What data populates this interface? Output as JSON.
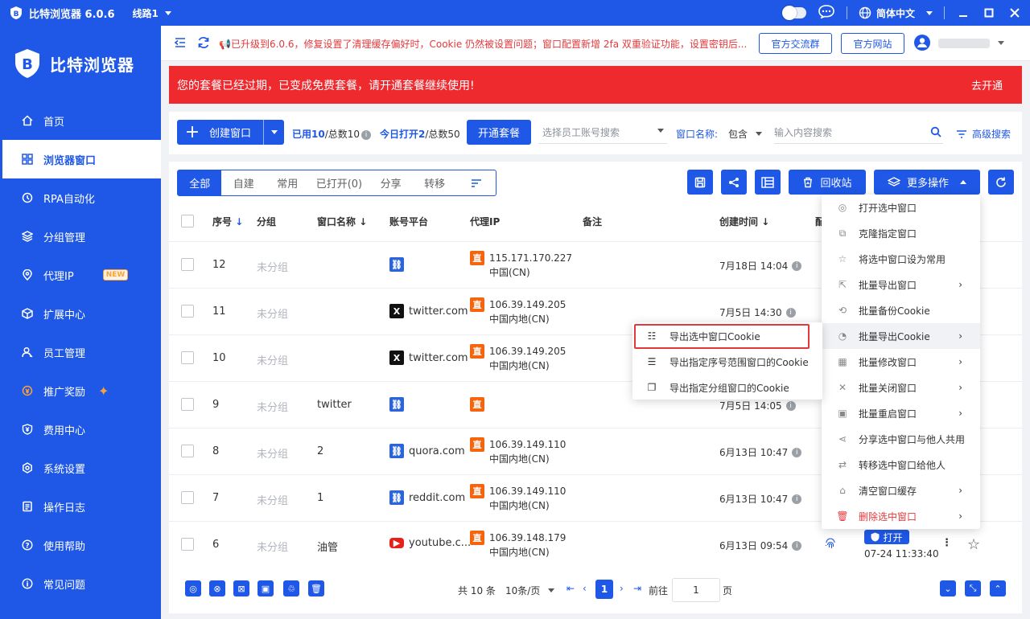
{
  "app": {
    "title": "比特浏览器 6.0.6",
    "route": "线路1",
    "language": "简体中文"
  },
  "sidebar": {
    "brand": "比特浏览器",
    "items": [
      {
        "label": "首页",
        "icon": "home-icon"
      },
      {
        "label": "浏览器窗口",
        "icon": "grid-icon",
        "active": true
      },
      {
        "label": "RPA自动化",
        "icon": "rpa-icon"
      },
      {
        "label": "分组管理",
        "icon": "layers-icon"
      },
      {
        "label": "代理IP",
        "icon": "location-icon",
        "badge": "NEW"
      },
      {
        "label": "扩展中心",
        "icon": "cube-icon"
      },
      {
        "label": "员工管理",
        "icon": "users-icon"
      },
      {
        "label": "推广奖励",
        "icon": "reward-icon"
      },
      {
        "label": "费用中心",
        "icon": "shield-yen-icon"
      },
      {
        "label": "系统设置",
        "icon": "settings-icon"
      },
      {
        "label": "操作日志",
        "icon": "log-icon"
      },
      {
        "label": "使用帮助",
        "icon": "help-icon"
      },
      {
        "label": "常见问题",
        "icon": "info-icon"
      }
    ]
  },
  "topbar": {
    "notice": "📢已升级到6.0.6，修复设置了清理缓存偏好时，Cookie 仍然被设置问题；窗口配置新增 2fa 双重验证功能，设置密钥后...",
    "group_button": "官方交流群",
    "site_button": "官方网站"
  },
  "banner": {
    "text": "您的套餐已经过期，已变成免费套餐，请开通套餐继续使用!",
    "action": "去开通"
  },
  "toolbar": {
    "create_label": "创建窗口",
    "used_prefix": "已用10",
    "used_suffix": "/总数10",
    "opened_prefix": "今日打开2",
    "opened_suffix": "/总数50",
    "subscribe_label": "开通套餐",
    "employee_placeholder": "选择员工账号搜索",
    "filter_name_label": "窗口名称:",
    "filter_mode": "包含",
    "search_placeholder": "输入内容搜索",
    "advanced_label": "高级搜索"
  },
  "tabs": [
    "全部",
    "自建",
    "常用",
    "已打开(0)",
    "分享",
    "转移"
  ],
  "actions": {
    "recycle_label": "回收站",
    "more_label": "更多操作"
  },
  "table": {
    "headers": {
      "seq": "序号",
      "group": "分组",
      "name": "窗口名称",
      "platform": "账号平台",
      "proxy": "代理IP",
      "remark": "备注",
      "created": "创建时间",
      "col_partial": "配"
    },
    "rows": [
      {
        "seq": "12",
        "group": "未分组",
        "name": "",
        "platform": "",
        "platform_icon": "link",
        "ip": "115.171.170.227",
        "region": "中国(CN)",
        "created": "7月18日 14:04"
      },
      {
        "seq": "11",
        "group": "未分组",
        "name": "",
        "platform": "twitter.com",
        "platform_icon": "x",
        "ip": "106.39.149.205",
        "region": "中国内地(CN)",
        "created": "7月5日 14:30"
      },
      {
        "seq": "10",
        "group": "未分组",
        "name": "",
        "platform": "twitter.com",
        "platform_icon": "x",
        "ip": "106.39.149.205",
        "region": "中国内地(CN)",
        "created": ""
      },
      {
        "seq": "9",
        "group": "未分组",
        "name": "twitter",
        "platform": "",
        "platform_icon": "link",
        "ip": "",
        "region": "",
        "created": "7月5日 14:05"
      },
      {
        "seq": "8",
        "group": "未分组",
        "name": "2",
        "platform": "quora.com",
        "platform_icon": "link",
        "ip": "106.39.149.110",
        "region": "中国内地(CN)",
        "created": "6月13日 10:47"
      },
      {
        "seq": "7",
        "group": "未分组",
        "name": "1",
        "platform": "reddit.com",
        "platform_icon": "link",
        "ip": "106.39.149.110",
        "region": "中国内地(CN)",
        "created": "6月13日 10:47"
      },
      {
        "seq": "6",
        "group": "未分组",
        "name": "油管",
        "platform": "youtube.c...",
        "platform_icon": "youtube",
        "ip": "106.39.148.179",
        "region": "中国内地(CN)",
        "created": "6月13日 09:54",
        "open_label": "打开",
        "last_open": "07-24 11:33:40"
      }
    ]
  },
  "pager": {
    "total": "共 10 条",
    "page_size": "10条/页",
    "current_page": "1",
    "goto_prefix": "前往",
    "goto_value": "1",
    "goto_suffix": "页"
  },
  "more_menu": [
    {
      "label": "打开选中窗口",
      "icon": "chrome-icon"
    },
    {
      "label": "克隆指定窗口",
      "icon": "clone-icon"
    },
    {
      "label": "将选中窗口设为常用",
      "icon": "star-icon"
    },
    {
      "label": "批量导出窗口",
      "icon": "export-icon",
      "arrow": true
    },
    {
      "label": "批量备份Cookie",
      "icon": "backup-icon"
    },
    {
      "label": "批量导出Cookie",
      "icon": "cookie-icon",
      "arrow": true,
      "highlight": true
    },
    {
      "label": "批量修改窗口",
      "icon": "edit-grid-icon",
      "arrow": true
    },
    {
      "label": "批量关闭窗口",
      "icon": "close-icon",
      "arrow": true
    },
    {
      "label": "批量重启窗口",
      "icon": "restart-icon",
      "arrow": true
    },
    {
      "label": "分享选中窗口与他人共用",
      "icon": "share-icon"
    },
    {
      "label": "转移选中窗口给他人",
      "icon": "transfer-icon"
    },
    {
      "label": "清空窗口缓存",
      "icon": "broom-icon",
      "arrow": true
    },
    {
      "label": "删除选中窗口",
      "icon": "trash-icon",
      "arrow": true,
      "danger": true
    }
  ],
  "cookie_submenu": [
    {
      "label": "导出选中窗口Cookie",
      "icon": "checklist-icon"
    },
    {
      "label": "导出指定序号范围窗口的Cookie",
      "icon": "range-list-icon"
    },
    {
      "label": "导出指定分组窗口的Cookie",
      "icon": "group-copy-icon"
    }
  ],
  "colors": {
    "primary": "#1f58e6",
    "danger": "#ef2a2f",
    "proxy_tag": "#f5650f",
    "badge": "#f9a23b"
  }
}
